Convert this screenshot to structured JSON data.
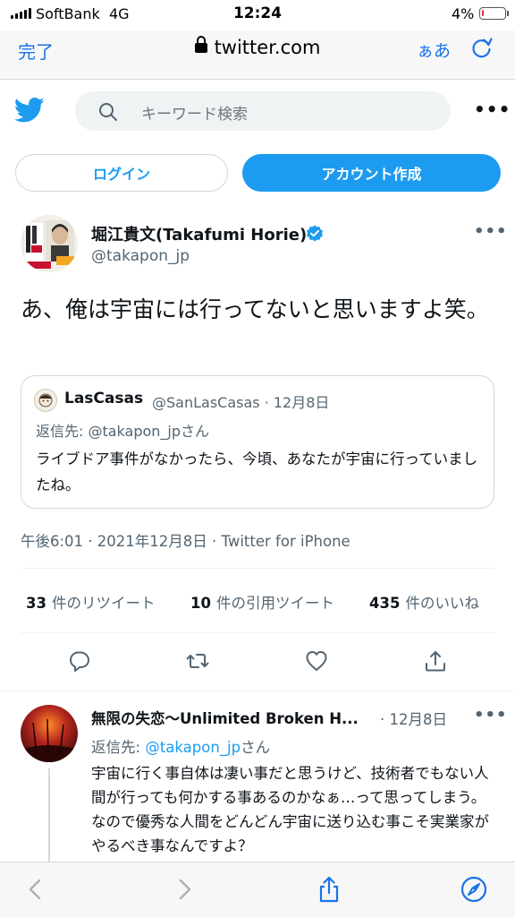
{
  "status": {
    "carrier": "SoftBank",
    "network": "4G",
    "time": "12:24",
    "battery": "4%",
    "battery_level": 0.04
  },
  "browser": {
    "done": "完了",
    "url": "twitter.com",
    "text_size": "ぁあ",
    "reload_icon": "reload-icon"
  },
  "twitter": {
    "logo_icon": "twitter-bird-icon",
    "search_placeholder": "キーワード検索",
    "login": "ログイン",
    "signup": "アカウント作成",
    "brand_color": "#1d9bf0"
  },
  "tweet": {
    "author_name": "堀江貴文(Takafumi Horie)",
    "handle": "@takapon_jp",
    "text": "あ、俺は宇宙には行ってないと思いますよ笑。",
    "quote": {
      "name": "LasCasas",
      "handle_date": "@SanLasCasas · 12月8日",
      "replying": "返信先: @takapon_jpさん",
      "text": "ライブドア事件がなかったら、今頃、あなたが宇宙に行っていましたね。"
    },
    "meta": "午後6:01 · 2021年12月8日 · Twitter for iPhone",
    "stats": {
      "retweets_count": "33",
      "retweets_label": "件のリツイート",
      "quotes_count": "10",
      "quotes_label": "件の引用ツイート",
      "likes_count": "435",
      "likes_label": "件のいいね"
    }
  },
  "reply": {
    "name": "無限の失恋〜Unlimited Broken H...",
    "date": "· 12月8日",
    "replying_prefix": "返信先: ",
    "replying_handle": "@takapon_jp",
    "replying_suffix": "さん",
    "text": "宇宙に行く事自体は凄い事だと思うけど、技術者でもない人間が行っても何かする事あるのかなぁ…って思ってしまう。 なので優秀な人間をどんどん宇宙に送り込む事こそ実業家がやるべき事なんですよ？"
  }
}
